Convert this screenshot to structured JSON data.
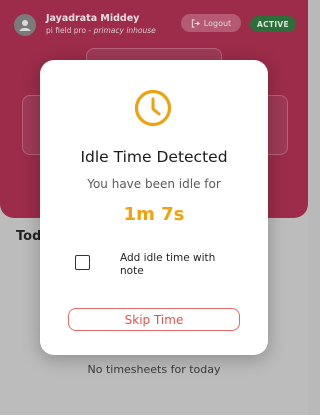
{
  "header": {
    "user_name": "Jayadrata Middey",
    "app_name": "pi field pro",
    "separator": " - ",
    "company": "primacy inhouse",
    "logout_label": "Logout",
    "status_label": "ACTIVE"
  },
  "main": {
    "section_title": "Today",
    "empty_text": "No timesheets for today"
  },
  "modal": {
    "title": "Idle Time Detected",
    "subtitle": "You have been idle for",
    "idle_duration": "1m 7s",
    "checkbox_label": "Add idle time with note",
    "checkbox_checked": false,
    "skip_label": "Skip Time",
    "icon": "clock-icon"
  },
  "colors": {
    "hero": "#9c2c4a",
    "accent": "#f0a20e",
    "danger": "#e0534f",
    "active": "#2c6d3a"
  }
}
